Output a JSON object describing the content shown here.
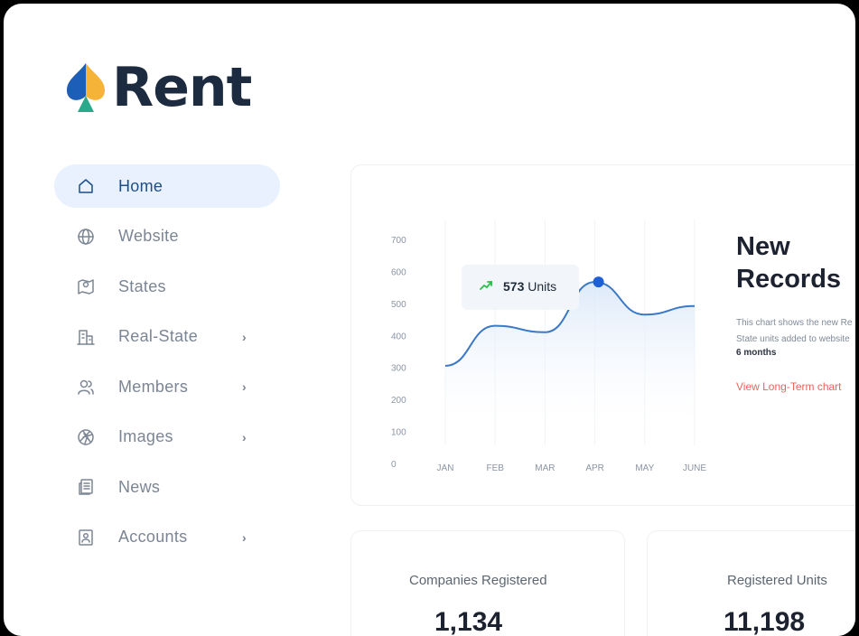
{
  "brand": {
    "name": "Rent"
  },
  "nav": [
    {
      "label": "Home",
      "icon": "home-icon",
      "active": true,
      "has_submenu": false
    },
    {
      "label": "Website",
      "icon": "globe-icon",
      "active": false,
      "has_submenu": false
    },
    {
      "label": "States",
      "icon": "map-pin-icon",
      "active": false,
      "has_submenu": false
    },
    {
      "label": "Real-State",
      "icon": "building-icon",
      "active": false,
      "has_submenu": true
    },
    {
      "label": "Members",
      "icon": "users-icon",
      "active": false,
      "has_submenu": true
    },
    {
      "label": "Images",
      "icon": "aperture-icon",
      "active": false,
      "has_submenu": true
    },
    {
      "label": "News",
      "icon": "newspaper-icon",
      "active": false,
      "has_submenu": false
    },
    {
      "label": "Accounts",
      "icon": "id-card-icon",
      "active": false,
      "has_submenu": true
    }
  ],
  "chevron": "›",
  "records": {
    "title": "New Records",
    "description": "This chart shows the new Re\nState units added to website",
    "period": "6 months",
    "link": "View Long-Term chart"
  },
  "tooltip": {
    "value": "573",
    "unit": "Units"
  },
  "chart_data": {
    "type": "area",
    "categories": [
      "JAN",
      "FEB",
      "MAR",
      "APR",
      "MAY",
      "JUNE"
    ],
    "y_ticks": [
      0,
      100,
      200,
      300,
      400,
      500,
      600,
      700
    ],
    "ylim": [
      0,
      700
    ],
    "series": [
      {
        "values": [
          305,
          430,
          410,
          567,
          465,
          492
        ]
      }
    ],
    "highlight": {
      "x": "APR",
      "y": 567
    },
    "grid": true,
    "line_color": "#3b78c5",
    "marker_color": "#1d5fd6"
  },
  "stats": [
    {
      "title": "Companies Registered",
      "value": "1,134"
    },
    {
      "title": "Registered Units",
      "value": "11,198"
    }
  ],
  "colors": {
    "accent": "#1d4f86",
    "active_bg": "#e8f1fd",
    "link": "#e8645d"
  }
}
